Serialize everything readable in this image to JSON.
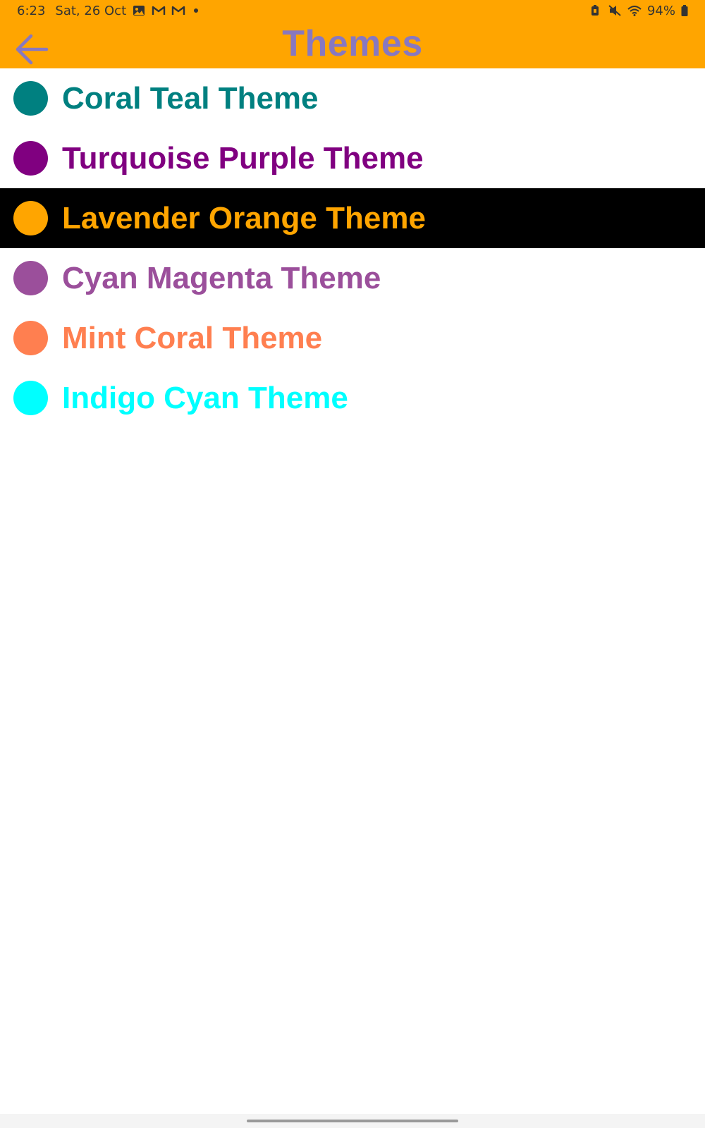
{
  "status_bar": {
    "time": "6:23",
    "date": "Sat, 26 Oct",
    "battery": "94%",
    "icons": [
      "gallery-icon",
      "gmail-icon",
      "gmail-icon",
      "notification-dot",
      "battery-saver-icon",
      "mute-icon",
      "wifi-icon",
      "battery-icon"
    ]
  },
  "app_bar": {
    "title": "Themes",
    "back_icon": "arrow-left-icon",
    "background_color": "#FFA500",
    "title_color": "#8878C0"
  },
  "themes": [
    {
      "label": "Coral Teal Theme",
      "color": "#008080",
      "selected": false
    },
    {
      "label": "Turquoise Purple Theme",
      "color": "#800080",
      "selected": false
    },
    {
      "label": "Lavender Orange Theme",
      "color": "#FFA500",
      "selected": true
    },
    {
      "label": "Cyan Magenta Theme",
      "color": "#9B4F9B",
      "selected": false
    },
    {
      "label": "Mint Coral Theme",
      "color": "#FF7F50",
      "selected": false
    },
    {
      "label": "Indigo Cyan Theme",
      "color": "#00FFFF",
      "selected": false
    }
  ]
}
